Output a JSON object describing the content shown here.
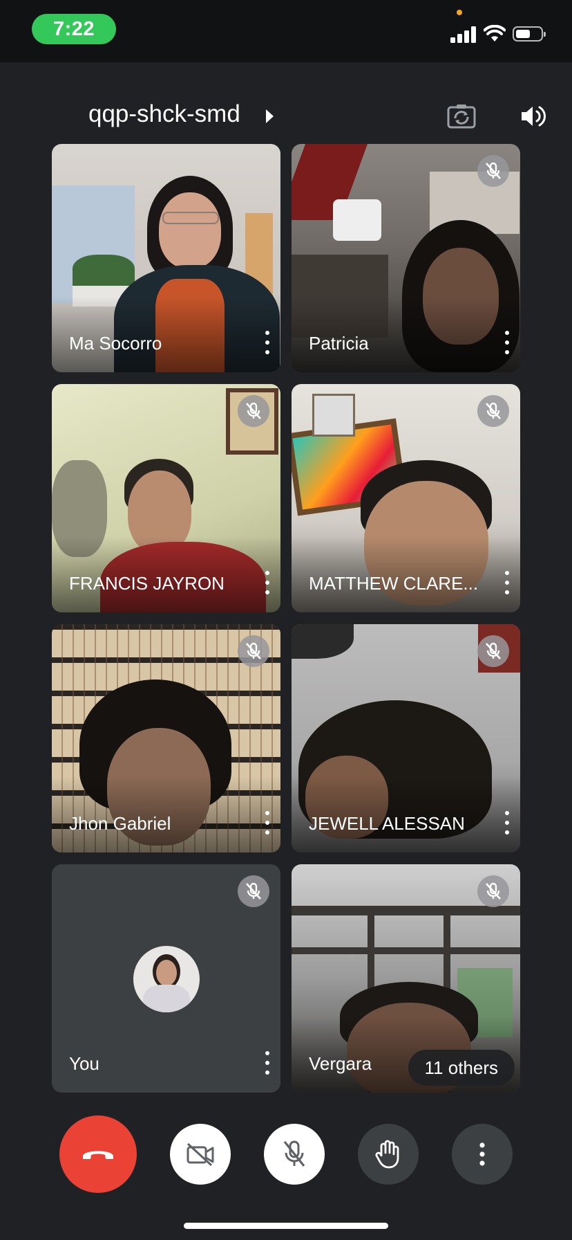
{
  "status_bar": {
    "time": "7:22"
  },
  "header": {
    "meeting_code": "qqp-shck-smd"
  },
  "participants": [
    {
      "name": "Ma Socorro",
      "muted": false
    },
    {
      "name": "Patricia",
      "muted": true
    },
    {
      "name": "FRANCIS JAYRON",
      "muted": true
    },
    {
      "name": "MATTHEW CLARE...",
      "muted": true
    },
    {
      "name": "Jhon Gabriel",
      "muted": true
    },
    {
      "name": "JEWELL ALESSAN",
      "muted": true
    },
    {
      "name": "You",
      "muted": true
    },
    {
      "name": "Vergara",
      "muted": true
    }
  ],
  "others_label": "11 others",
  "controls": [
    "end-call",
    "camera-off",
    "mic-off",
    "raise-hand",
    "more-options"
  ],
  "colors": {
    "background": "#202124",
    "end_call": "#ea4335",
    "status_time": "#34c759"
  }
}
